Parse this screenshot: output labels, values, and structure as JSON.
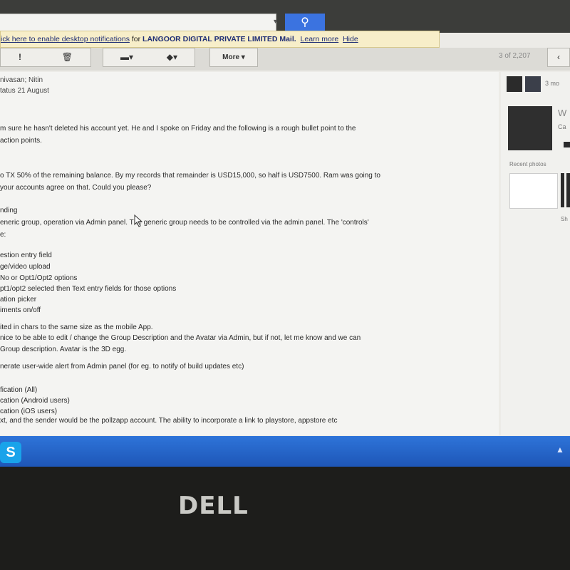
{
  "search": {
    "placeholder": "",
    "dropdown_glyph": "▾",
    "button_glyph": "⚲"
  },
  "notification": {
    "link_text": "ick here to enable desktop notifications",
    "text": " for ",
    "brand": "LANGOOR DIGITAL PRIVATE LIMITED Mail.",
    "learn_more": "Learn more",
    "hide": "Hide"
  },
  "toolbar": {
    "report_icon": "!",
    "delete_icon": "🗑",
    "folder_label": "▾",
    "labels_label": "▾",
    "more_label": "More ▾",
    "pager": "3 of 2,207",
    "prev_glyph": "‹"
  },
  "email": {
    "header_line1": "nivasan; Nitin",
    "header_line2": "tatus 21 August",
    "lines": [
      "m sure he hasn't deleted his account yet.  He and I spoke on Friday and the following is a rough bullet point to the",
      "action points.",
      "o TX 50% of the remaining balance. By my records that remainder is USD15,000, so half is USD7500. Ram was going to",
      " your accounts agree on that. Could you please?",
      "nding",
      "eneric group, operation via Admin panel. The generic group needs to be controlled via the admin panel. The 'controls'",
      "e:",
      "estion entry field",
      "ge/video upload",
      "No or Opt1/Opt2 options",
      "pt1/opt2 selected then Text entry fields for those options",
      "ation picker",
      "iments on/off",
      "ited in chars to the same size as the mobile App.",
      " nice to be able to edit / change the Group Description and the Avatar via Admin, but if not, let me know and we can",
      " Group description. Avatar is the 3D egg.",
      "nerate user-wide alert from Admin panel (for eg. to notify of build updates etc)",
      "fication (All)",
      "cation (Android users)",
      "cation (iOS users)",
      "xt, and the sender would be the pollzapp account. The ability to incorporate a link to playstore, appstore etc"
    ]
  },
  "sidebar": {
    "count_text": "3 mo",
    "name_initial": "W",
    "sub_text": "Ca",
    "recent_photos": "Recent photos",
    "show_text": "Sh"
  },
  "taskbar": {
    "app_icon": "S",
    "tray_glyph": "▲"
  },
  "bezel": {
    "brand": "DELL"
  }
}
